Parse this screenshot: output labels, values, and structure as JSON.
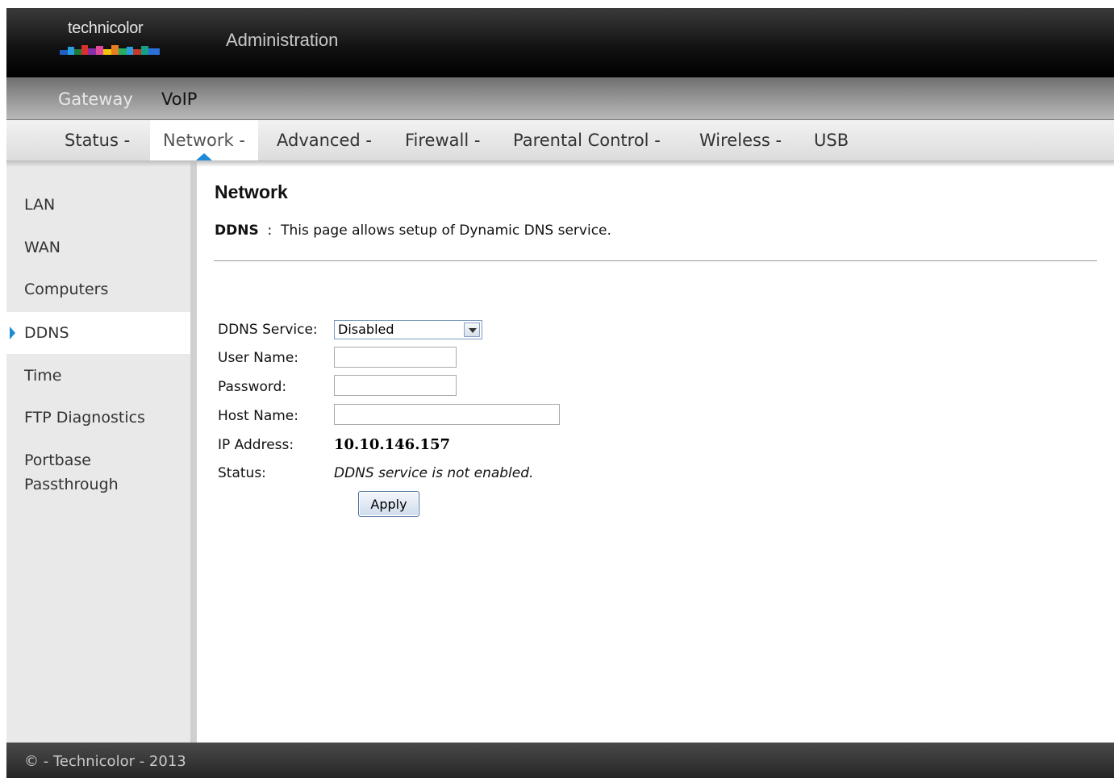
{
  "header": {
    "logo_text": "technicolor",
    "app_title": "Administration"
  },
  "subnav": {
    "items": [
      "Gateway",
      "VoIP"
    ]
  },
  "mainnav": {
    "items": [
      "Status -",
      "Network -",
      "Advanced -",
      "Firewall -",
      "Parental Control -",
      "Wireless -",
      "USB"
    ],
    "active": "Network -"
  },
  "sidebar": {
    "items": [
      "LAN",
      "WAN",
      "Computers",
      "DDNS",
      "Time",
      "FTP Diagnostics",
      "Portbase",
      "Passthrough"
    ],
    "active": "DDNS"
  },
  "page": {
    "title": "Network",
    "desc_key": "DDNS",
    "desc_sep": ":",
    "desc_text": "This page allows setup of Dynamic DNS service."
  },
  "form": {
    "ddns_service_label": "DDNS Service:",
    "ddns_service_value": "Disabled",
    "user_name_label": "User Name:",
    "user_name_value": "",
    "password_label": "Password:",
    "password_value": "",
    "host_name_label": "Host Name:",
    "host_name_value": "",
    "ip_address_label": "IP Address:",
    "ip_address_value": "10.10.146.157",
    "status_label": "Status:",
    "status_value": "DDNS service is not enabled.",
    "apply_label": "Apply"
  },
  "footer": {
    "text": "© - Technicolor - 2013"
  },
  "colors": {
    "accent": "#1e8bd8"
  }
}
